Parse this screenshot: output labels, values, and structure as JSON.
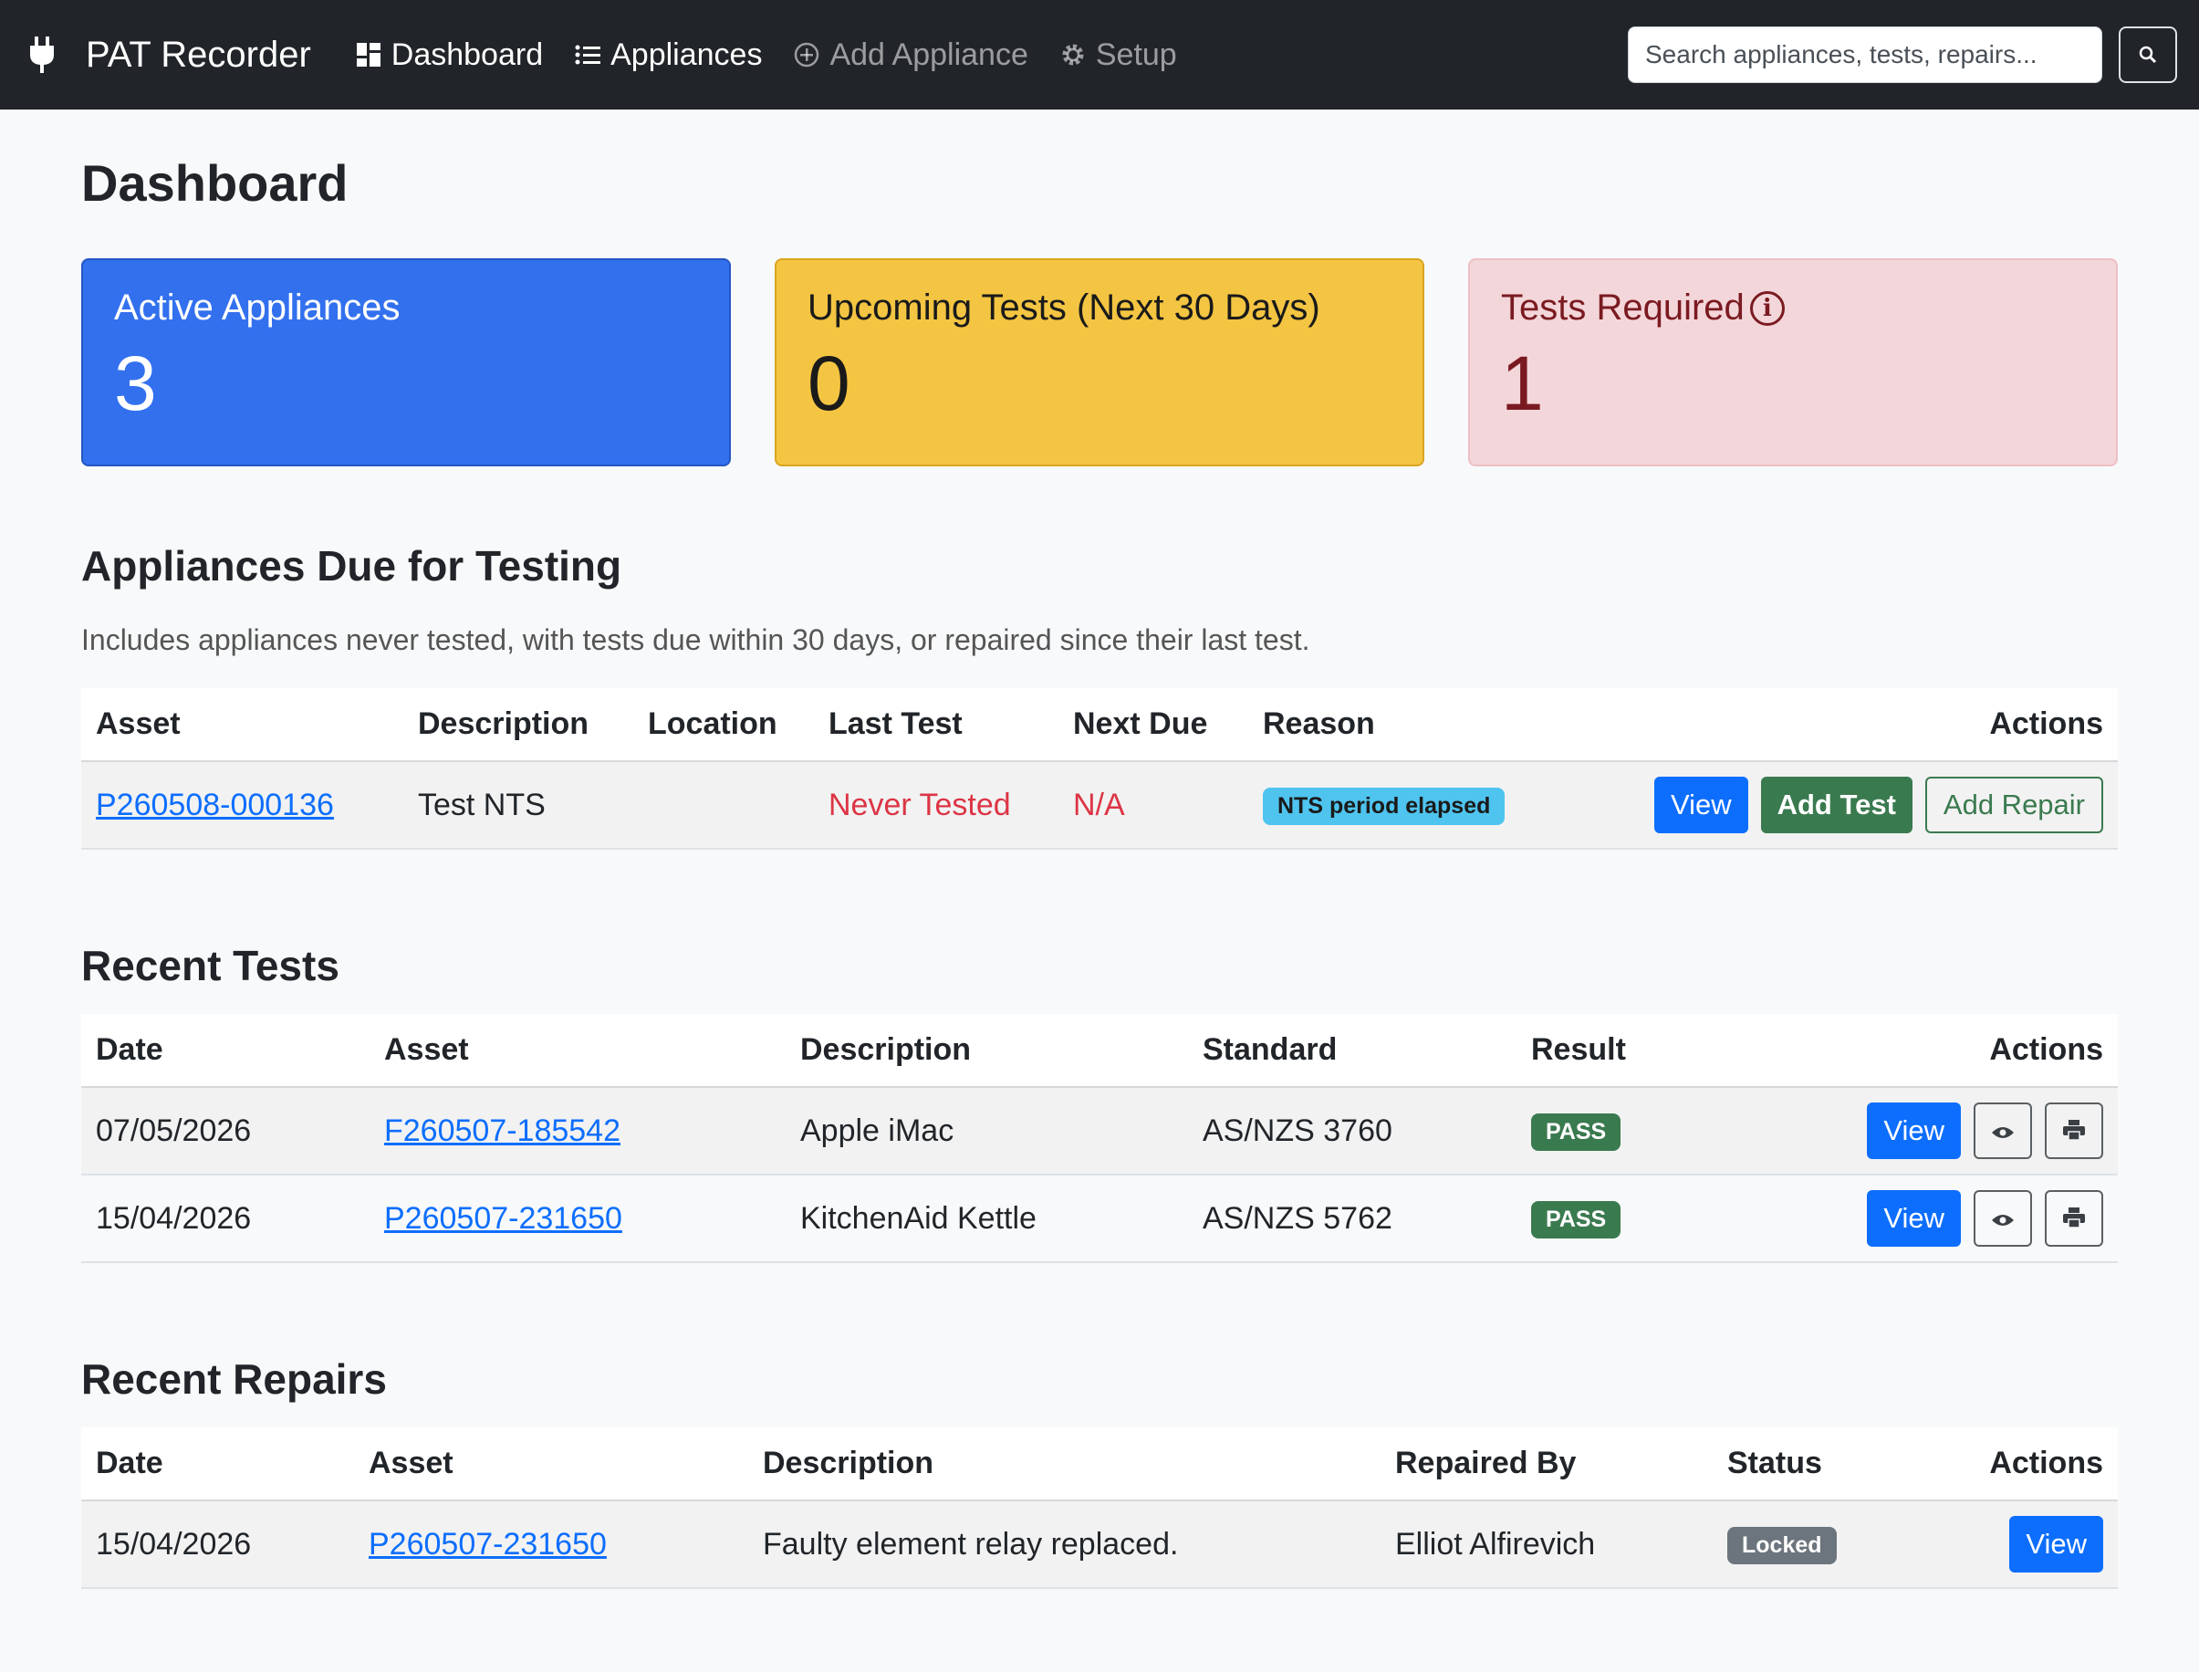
{
  "nav": {
    "brand": "PAT Recorder",
    "items": [
      {
        "label": "Dashboard",
        "icon": "grid-icon"
      },
      {
        "label": "Appliances",
        "icon": "list-icon"
      },
      {
        "label": "Add Appliance",
        "icon": "plus-circle-icon"
      },
      {
        "label": "Setup",
        "icon": "gear-icon"
      }
    ],
    "search_placeholder": "Search appliances, tests, repairs..."
  },
  "page_title": "Dashboard",
  "cards": {
    "active": {
      "title": "Active Appliances",
      "value": "3",
      "color": "#3270ee"
    },
    "upcoming": {
      "title": "Upcoming Tests (Next 30 Days)",
      "value": "0",
      "color": "#f4c542"
    },
    "required": {
      "title": "Tests Required",
      "value": "1",
      "color": "#f3d6da"
    }
  },
  "due": {
    "title": "Appliances Due for Testing",
    "note": "Includes appliances never tested, with tests due within 30 days, or repaired since their last test.",
    "headers": [
      "Asset",
      "Description",
      "Location",
      "Last Test",
      "Next Due",
      "Reason",
      "Actions"
    ],
    "rows": [
      {
        "asset": "P260508-000136",
        "description": "Test NTS",
        "location": "",
        "last_test": "Never Tested",
        "next_due": "N/A",
        "reason": "NTS period elapsed",
        "view": "View",
        "add_test": "Add Test",
        "add_repair": "Add Repair"
      }
    ]
  },
  "tests": {
    "title": "Recent Tests",
    "headers": [
      "Date",
      "Asset",
      "Description",
      "Standard",
      "Result",
      "Actions"
    ],
    "rows": [
      {
        "date": "07/05/2026",
        "asset": "F260507-185542",
        "description": "Apple iMac",
        "standard": "AS/NZS 3760",
        "result": "PASS",
        "view": "View"
      },
      {
        "date": "15/04/2026",
        "asset": "P260507-231650",
        "description": "KitchenAid Kettle",
        "standard": "AS/NZS 5762",
        "result": "PASS",
        "view": "View"
      }
    ]
  },
  "repairs": {
    "title": "Recent Repairs",
    "headers": [
      "Date",
      "Asset",
      "Description",
      "Repaired By",
      "Status",
      "Actions"
    ],
    "rows": [
      {
        "date": "15/04/2026",
        "asset": "P260507-231650",
        "description": "Faulty element relay replaced.",
        "repaired_by": "Elliot Alfirevich",
        "status": "Locked",
        "view": "View"
      }
    ]
  }
}
